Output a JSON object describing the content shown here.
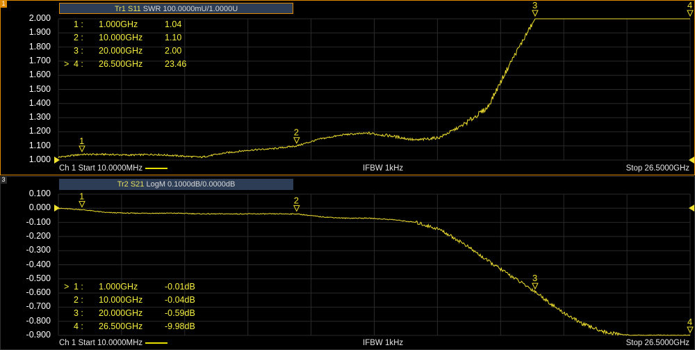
{
  "colors": {
    "trace": "#f0e030",
    "grid": "#2a2a2a",
    "active_border": "#e08a00",
    "title_bg": "#2c3d55"
  },
  "sweep": {
    "start_hz": 10000000,
    "stop_hz": 26500000000
  },
  "panes": [
    {
      "channel_badge": "1",
      "title_trace": "Tr1 S11",
      "title_rest": "SWR 100.0000mU/1.0000U",
      "y_labels": [
        "2.000",
        "1.900",
        "1.800",
        "1.700",
        "1.600",
        "1.500",
        "1.400",
        "1.300",
        "1.200",
        "1.100",
        "1.000"
      ],
      "footer": {
        "start": "Ch 1 Start 10.0000MHz",
        "center": "IFBW 1kHz",
        "stop": "Stop 26.5000GHz"
      },
      "markers": [
        {
          "prefix": "",
          "id": "1 :",
          "freq": "1.000GHz",
          "value": "1.04"
        },
        {
          "prefix": "",
          "id": "2 :",
          "freq": "10.000GHz",
          "value": "1.10"
        },
        {
          "prefix": "",
          "id": "3 :",
          "freq": "20.000GHz",
          "value": "2.00"
        },
        {
          "prefix": ">",
          "id": "4 :",
          "freq": "26.500GHz",
          "value": "23.46"
        }
      ],
      "marker_labels": [
        "1",
        "2",
        "3",
        "4"
      ]
    },
    {
      "channel_badge": "3",
      "title_trace": "Tr2 S21",
      "title_rest": "LogM 0.1000dB/0.0000dB",
      "y_labels": [
        "0.100",
        "0.000",
        "-0.100",
        "-0.200",
        "-0.300",
        "-0.400",
        "-0.500",
        "-0.600",
        "-0.700",
        "-0.800",
        "-0.900"
      ],
      "footer": {
        "start": "Ch 1 Start 10.0000MHz",
        "center": "IFBW 1kHz",
        "stop": "Stop 26.5000GHz"
      },
      "markers": [
        {
          "prefix": ">",
          "id": "1 :",
          "freq": "1.000GHz",
          "value": "-0.01dB"
        },
        {
          "prefix": "",
          "id": "2 :",
          "freq": "10.000GHz",
          "value": "-0.04dB"
        },
        {
          "prefix": "",
          "id": "3 :",
          "freq": "20.000GHz",
          "value": "-0.59dB"
        },
        {
          "prefix": "",
          "id": "4 :",
          "freq": "26.500GHz",
          "value": "-9.98dB"
        }
      ],
      "marker_labels": [
        "1",
        "2",
        "3",
        "4"
      ]
    }
  ],
  "chart_data": [
    {
      "type": "line",
      "title": "Tr1 S11 SWR 100.0000mU/1.0000U",
      "xlabel": "",
      "ylabel": "",
      "xlim": [
        0.01,
        26.5
      ],
      "ylim": [
        1.0,
        2.0
      ],
      "grid": true,
      "series": [
        {
          "name": "Tr1 S11",
          "x": [
            0.01,
            0.5,
            1,
            2,
            3,
            4,
            5,
            6,
            7,
            8,
            9,
            10,
            11,
            12,
            13,
            14,
            15,
            16,
            17,
            18,
            19,
            20,
            20.5,
            21,
            21.5,
            22,
            23,
            24,
            25,
            26.5
          ],
          "values": [
            1.02,
            1.03,
            1.04,
            1.04,
            1.035,
            1.04,
            1.03,
            1.02,
            1.05,
            1.07,
            1.08,
            1.1,
            1.15,
            1.18,
            1.19,
            1.17,
            1.14,
            1.16,
            1.25,
            1.37,
            1.7,
            2.0,
            2.0,
            2.0,
            2.0,
            2.0,
            2.0,
            2.0,
            2.0,
            2.0
          ]
        }
      ],
      "markers": [
        {
          "label": "1",
          "x": 1,
          "y": 1.04
        },
        {
          "label": "2",
          "x": 10,
          "y": 1.1
        },
        {
          "label": "3",
          "x": 20,
          "y": 2.0
        },
        {
          "label": "4",
          "x": 26.5,
          "y": 23.46
        }
      ]
    },
    {
      "type": "line",
      "title": "Tr2 S21 LogM 0.1000dB/0.0000dB",
      "xlabel": "",
      "ylabel": "",
      "xlim": [
        0.01,
        26.5
      ],
      "ylim": [
        -0.9,
        0.1
      ],
      "grid": true,
      "series": [
        {
          "name": "Tr2 S21",
          "x": [
            0.01,
            1,
            2,
            3,
            4,
            5,
            6,
            7,
            8,
            9,
            10,
            11,
            12,
            13,
            14,
            15,
            16,
            17,
            18,
            19,
            20,
            21,
            22,
            23,
            24,
            25,
            26.5
          ],
          "values": [
            0.0,
            -0.01,
            -0.03,
            -0.035,
            -0.035,
            -0.035,
            -0.04,
            -0.04,
            -0.04,
            -0.04,
            -0.04,
            -0.06,
            -0.07,
            -0.07,
            -0.08,
            -0.1,
            -0.15,
            -0.25,
            -0.37,
            -0.48,
            -0.59,
            -0.72,
            -0.82,
            -0.88,
            -0.9,
            -0.9,
            -0.9
          ]
        }
      ],
      "markers": [
        {
          "label": "1",
          "x": 1,
          "y": -0.01
        },
        {
          "label": "2",
          "x": 10,
          "y": -0.04
        },
        {
          "label": "3",
          "x": 20,
          "y": -0.59
        },
        {
          "label": "4",
          "x": 26.5,
          "y": -9.98
        }
      ]
    }
  ]
}
